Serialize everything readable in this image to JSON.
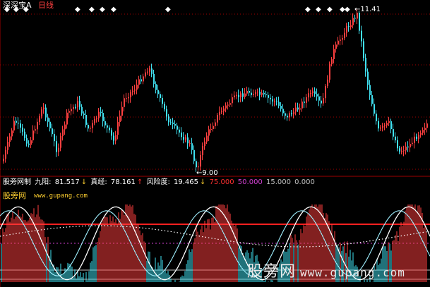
{
  "header": {
    "title": "深深宝A",
    "period": "日线"
  },
  "main_chart": {
    "high_label": "11.41",
    "low_label": "9.00",
    "markers_count": 16
  },
  "indicator": {
    "name": "股旁网制",
    "k_label": "九阳:",
    "k_value": "81.517",
    "k_arrow": "↓",
    "d_label": "真经:",
    "d_value": "78.161",
    "d_arrow": "↑",
    "risk_label": "风险度:",
    "risk_value": "19.465",
    "risk_arrow": "↓",
    "level1": "75.000",
    "level2": "50.000",
    "level3": "15.000",
    "level4": "0.000"
  },
  "sub_panel": {
    "brand": "股旁网",
    "url": "www.gupang.com"
  },
  "watermark": {
    "text": "股旁网",
    "url": "www.gupang.com"
  },
  "colors": {
    "up": "#ff4040",
    "down": "#40e0f0",
    "grid": "#a00000",
    "level_line": "#ff2020",
    "magenta": "#d040d0",
    "white": "#ffffff"
  }
}
